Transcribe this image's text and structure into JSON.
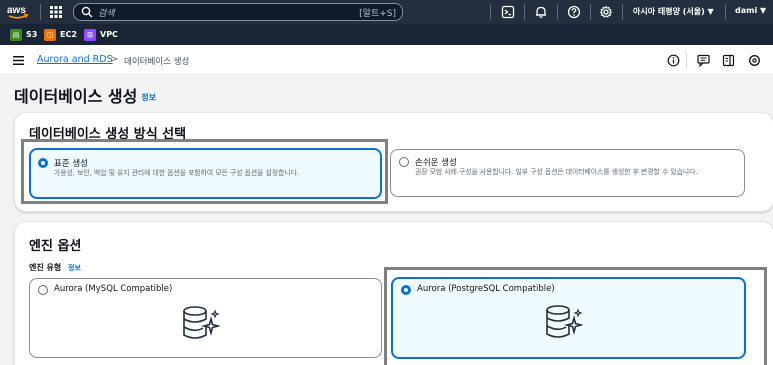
{
  "topnav": {
    "search_placeholder": "검색",
    "search_shortcut": "[알트+S]",
    "region": "아시아 태평양 (서울) ▼",
    "user": "dami ▼"
  },
  "favorites": [
    {
      "label": "S3",
      "color": "#3f8624"
    },
    {
      "label": "EC2",
      "color": "#ed7100"
    },
    {
      "label": "VPC",
      "color": "#8c4fff"
    }
  ],
  "breadcrumb": {
    "link": "Aurora and RDS",
    "separator": ">",
    "current": "데이터베이스 생성"
  },
  "page": {
    "title": "데이터베이스 생성",
    "info": "정보"
  },
  "creation_method": {
    "title": "데이터베이스 생성 방식 선택",
    "options": [
      {
        "label": "표준 생성",
        "desc": "가용성, 보안, 백업 및 유지 관리에 대한 옵션을 포함하여 모든 구성 옵션을 설정합니다.",
        "selected": true
      },
      {
        "label": "손쉬운 생성",
        "desc": "권장 모범 사례 구성을 사용합니다. 일부 구성 옵션은 데이터베이스를 생성한 후 변경할 수 있습니다.",
        "selected": false
      }
    ]
  },
  "engine": {
    "title": "엔진 옵션",
    "type_label": "엔진 유형",
    "info": "정보",
    "options": [
      {
        "label": "Aurora (MySQL Compatible)",
        "selected": false,
        "icon": "aurora-db-icon"
      },
      {
        "label": "Aurora (PostgreSQL Compatible)",
        "selected": true,
        "icon": "aurora-db-icon"
      }
    ]
  },
  "colors": {
    "accent": "#0972d3",
    "nav_bg": "#232f3e",
    "favbar_bg": "#192534"
  }
}
